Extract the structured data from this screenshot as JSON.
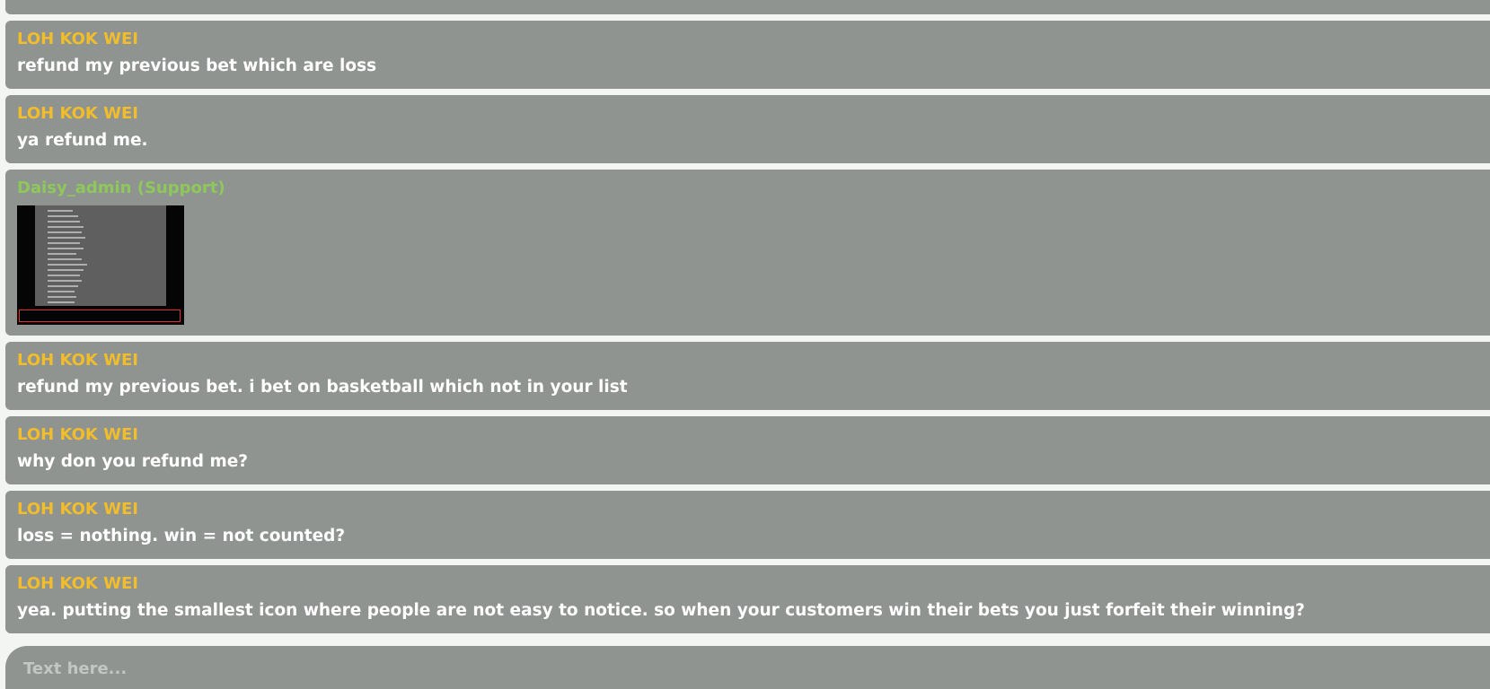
{
  "messages": [
    {
      "author": "LOH KOK WEI",
      "text": "refund my previous bet which are loss"
    },
    {
      "author": "LOH KOK WEI",
      "text": "ya refund me."
    },
    {
      "author": "Daisy_admin (Support)"
    },
    {
      "author": "LOH KOK WEI",
      "text": "refund my previous bet. i bet on basketball which not in your list"
    },
    {
      "author": "LOH KOK WEI",
      "text": "why don you refund me?"
    },
    {
      "author": "LOH KOK WEI",
      "text": "loss = nothing. win = not counted?"
    },
    {
      "author": "LOH KOK WEI",
      "text": "yea. putting the smallest icon where people are not easy to notice. so when your customers win their bets you just forfeit their winning?"
    }
  ],
  "composer": {
    "placeholder": "Text here..."
  },
  "colors": {
    "user_name": "#f2bd2b",
    "support_name": "#8fc85a",
    "bubble_bg": "#8f9490"
  }
}
